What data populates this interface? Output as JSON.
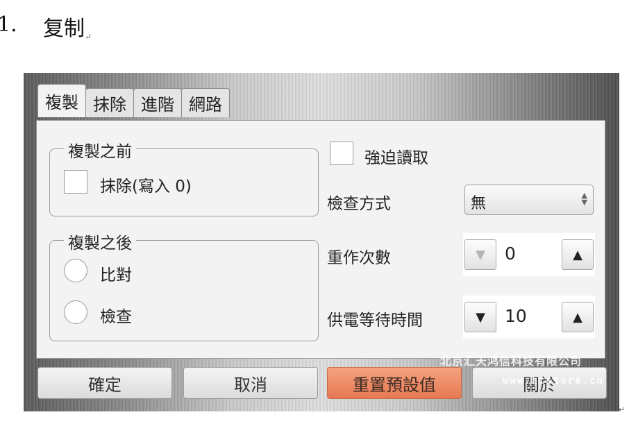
{
  "document": {
    "heading_number": "1.",
    "heading_text": "复制",
    "paragraph_mark": "↵"
  },
  "dialog": {
    "tabs": [
      {
        "label": "複製",
        "active": true
      },
      {
        "label": "抹除",
        "active": false
      },
      {
        "label": "進階",
        "active": false
      },
      {
        "label": "網路",
        "active": false
      }
    ],
    "before_copy": {
      "legend": "複製之前",
      "erase_label": "抹除(寫入 0)",
      "erase_checked": false
    },
    "after_copy": {
      "legend": "複製之後",
      "compare_label": "比對",
      "check_label": "檢查",
      "compare_selected": false,
      "check_selected": false
    },
    "force_read": {
      "label": "強迫讀取",
      "checked": false
    },
    "check_method": {
      "label": "檢查方式",
      "value": "無"
    },
    "retry_count": {
      "label": "重作次數",
      "value": "0"
    },
    "power_wait": {
      "label": "供電等待時間",
      "value": "10"
    },
    "buttons": {
      "ok": "確定",
      "cancel": "取消",
      "reset": "重置預設值",
      "about": "關於"
    },
    "watermark": {
      "line1": "北京汇天鸿信科技有限公司",
      "line2": "www.htstore.cn"
    },
    "colors": {
      "accent_button": "#ee8a64",
      "panel_bg": "#f3f3f3"
    }
  }
}
